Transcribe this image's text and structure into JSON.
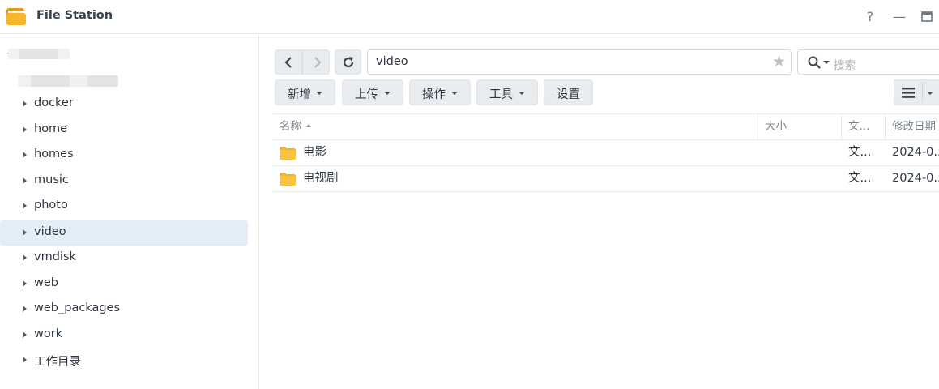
{
  "window": {
    "title": "File Station",
    "help_label": "?",
    "minimize_label": "—",
    "accent_color": "#4a90e2",
    "folder_color": "#f5b82e"
  },
  "sidebar": {
    "items": [
      {
        "label": "docker"
      },
      {
        "label": "home"
      },
      {
        "label": "homes"
      },
      {
        "label": "music"
      },
      {
        "label": "photo"
      },
      {
        "label": "video",
        "selected": true
      },
      {
        "label": "vmdisk"
      },
      {
        "label": "web"
      },
      {
        "label": "web_packages"
      },
      {
        "label": "work"
      },
      {
        "label": "工作目录"
      }
    ]
  },
  "toolbar": {
    "path_value": "video",
    "search_placeholder": "搜索",
    "buttons": [
      {
        "label": "新增"
      },
      {
        "label": "上传"
      },
      {
        "label": "操作"
      },
      {
        "label": "工具"
      },
      {
        "label": "设置"
      }
    ]
  },
  "table": {
    "columns": [
      "名称",
      "大小",
      "文...",
      "修改日期"
    ],
    "rows": [
      {
        "name": "电影",
        "size": "",
        "type": "文...",
        "modified": "2024-0..."
      },
      {
        "name": "电视剧",
        "size": "",
        "type": "文...",
        "modified": "2024-0..."
      }
    ]
  }
}
